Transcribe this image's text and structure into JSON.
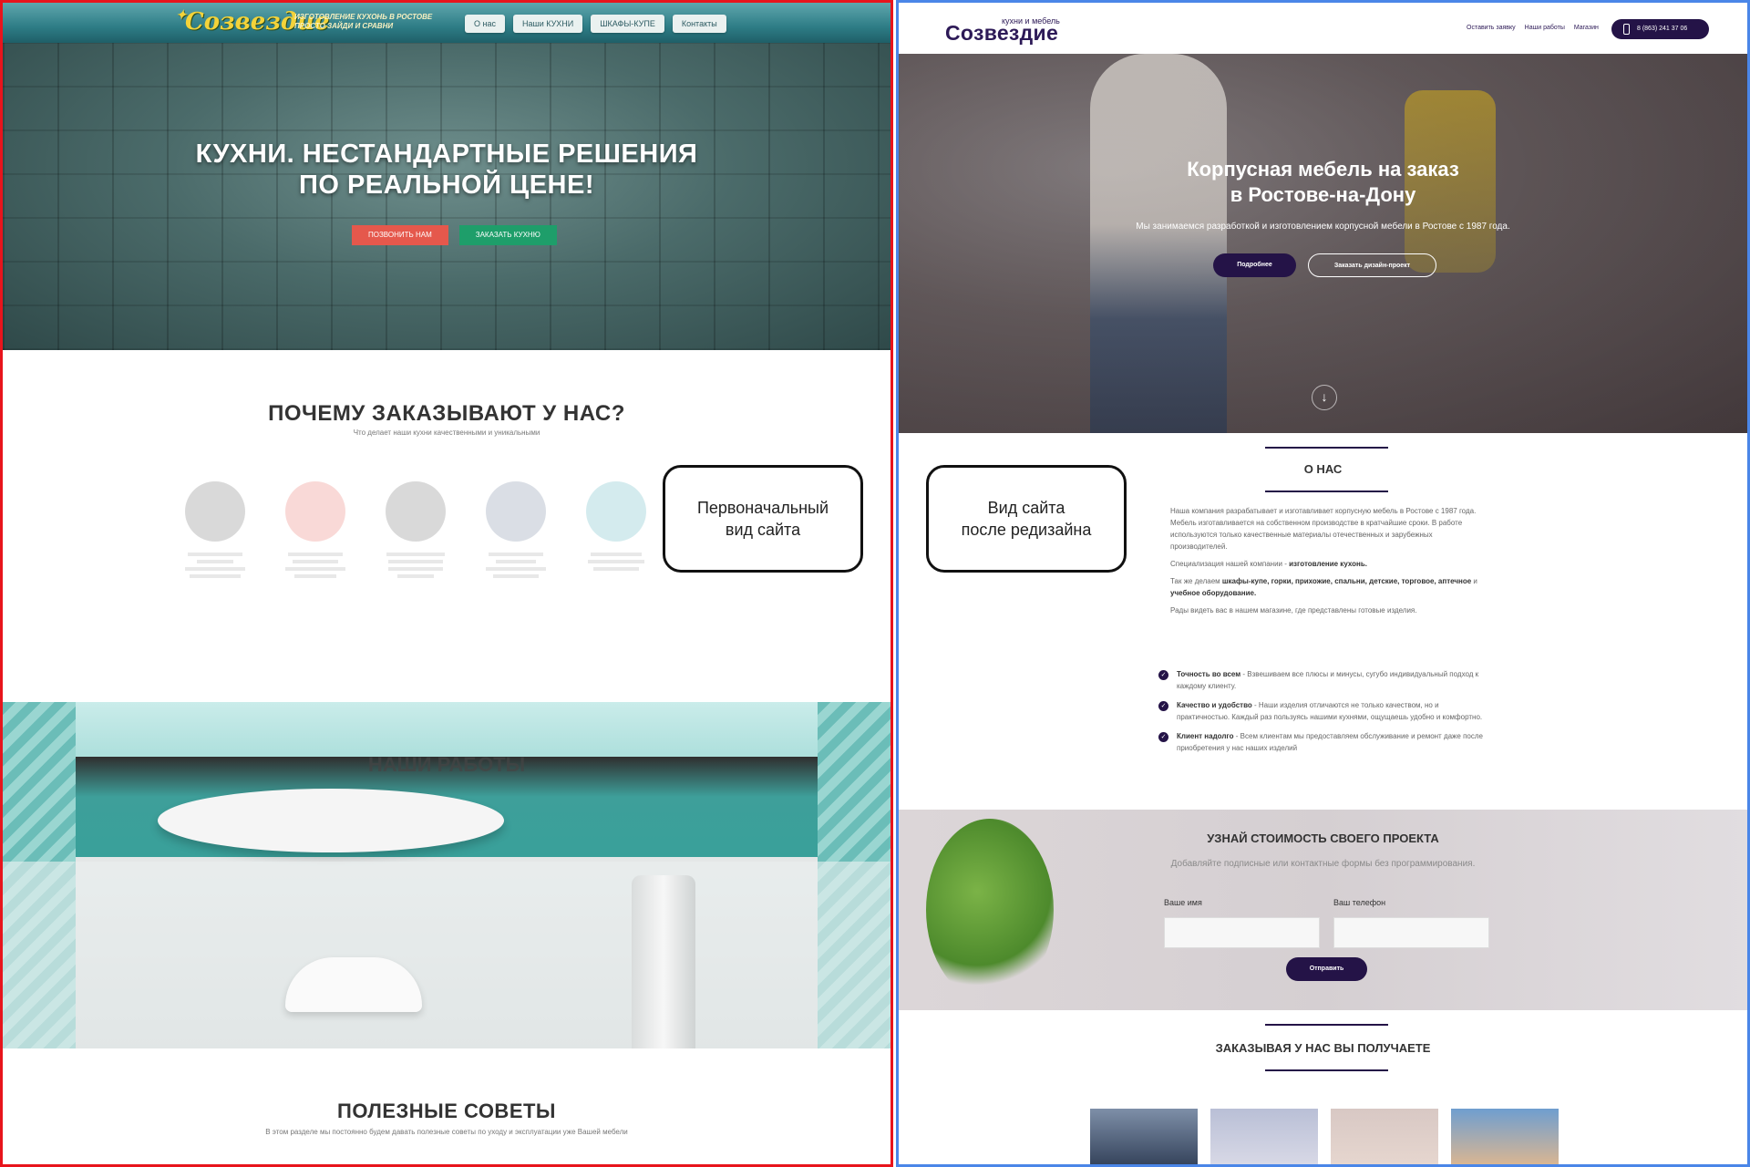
{
  "old_site": {
    "logo": "Созвездие",
    "tagline": [
      "ИЗГОТОВЛЕНИЕ КУХОНЬ В РОСТОВЕ",
      "ПРОСТО ЗАЙДИ И СРАВНИ"
    ],
    "nav": [
      "О нас",
      "Наши КУХНИ",
      "ШКАФЫ-КУПЕ",
      "Контакты"
    ],
    "hero": {
      "title_line1": "КУХНИ. НЕСТАНДАРТНЫЕ РЕШЕНИЯ",
      "title_line2": "ПО РЕАЛЬНОЙ ЦЕНЕ!",
      "btn_call": "ПОЗВОНИТЬ НАМ",
      "btn_order": "ЗАКАЗАТЬ КУХНЮ"
    },
    "why": {
      "title": "ПОЧЕМУ ЗАКАЗЫВАЮТ У НАС?",
      "subtitle": "Что делает наши кухни качественными и уникальными",
      "feature_colors": [
        "#555555",
        "#e5584c",
        "#555555",
        "#5a6e8c",
        "#3fa8b4"
      ]
    },
    "callout": [
      "Первоначальный",
      "вид сайта"
    ],
    "works_title": "НАШИ РАБОТЫ",
    "tips": {
      "title": "ПОЛЕЗНЫЕ СОВЕТЫ",
      "subtitle": "В этом разделе мы постоянно будем давать полезные советы по уходу и эксплуатации уже Вашей мебели"
    }
  },
  "new_site": {
    "logo_top": "кухни и мебель",
    "logo": "Созвездие",
    "nav": [
      "Оставить заявку",
      "Наши работы",
      "Магазин"
    ],
    "phone": "8 (863) 241 37 06",
    "hero": {
      "title_line1": "Корпусная мебель на заказ",
      "title_line2": "в Ростове-на-Дону",
      "subtitle": "Мы занимаемся разработкой и изготовлением корпусной мебели в Ростове с 1987 года.",
      "btn_more": "Подробнее",
      "btn_design": "Заказать дизайн-проект",
      "arrow_icon": "↓"
    },
    "about": {
      "title": "О НАС",
      "p1": "Наша компания разрабатывает и изготавливает корпусную мебель в Ростове с 1987 года. Мебель изготавливается на собственном производстве в кратчайшие сроки. В работе используются только качественные материалы отечественных и зарубежных производителей.",
      "p2_prefix": "Специализация нашей компании - ",
      "p2_bold": "изготовление кухонь.",
      "p3_prefix": "Так же делаем ",
      "p3_bold": "шкафы-купе, горки, прихожие, спальни, детские, торговое, аптечное",
      "p3_mid": " и ",
      "p3_bold2": "учебное оборудование.",
      "p4": "Рады видеть вас в нашем магазине, где представлены готовые изделия.",
      "checks": [
        {
          "title": "Точность во всем",
          "text": " - Взвешиваем все плюсы и минусы, сугубо индивидуальный подход к каждому клиенту."
        },
        {
          "title": "Качество и удобство",
          "text": " - Наши изделия отличаются не только качеством, но и практичностью. Каждый раз пользуясь нашими кухнями, ощущаешь удобно и комфортно."
        },
        {
          "title": "Клиент надолго",
          "text": " - Всем клиентам мы предоставляем обслуживание и ремонт даже после приобретения у нас наших изделий"
        }
      ]
    },
    "callout": [
      "Вид сайта",
      "после редизайна"
    ],
    "cost": {
      "title": "УЗНАЙ СТОИМОСТЬ СВОЕГО ПРОЕКТА",
      "subtitle": "Добавляйте подписные или контактные формы без программирования.",
      "name_label": "Ваше имя",
      "phone_label": "Ваш телефон",
      "submit": "Отправить"
    },
    "get_title": "ЗАКАЗЫВАЯ У НАС ВЫ ПОЛУЧАЕТЕ"
  }
}
